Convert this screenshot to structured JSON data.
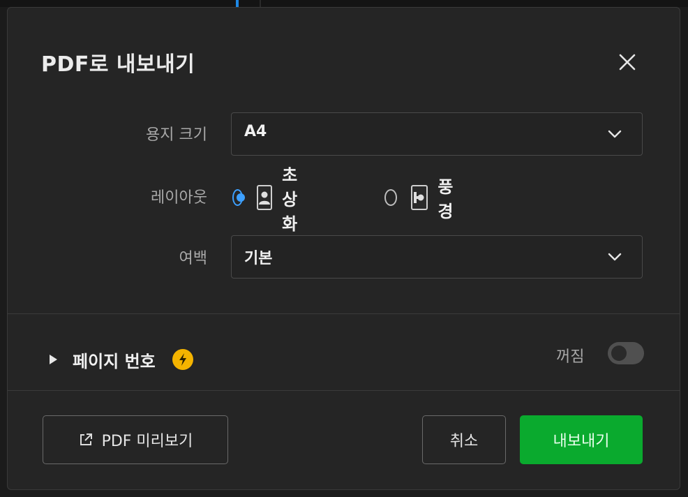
{
  "dialog": {
    "title": "PDF로 내보내기",
    "close_icon": "close-icon"
  },
  "paper_size": {
    "label": "용지 크기",
    "value": "A4"
  },
  "layout": {
    "label": "레이아웃",
    "options": [
      {
        "label": "초상화",
        "icon": "portrait-icon",
        "checked": true
      },
      {
        "label": "풍경",
        "icon": "landscape-icon",
        "checked": false
      }
    ]
  },
  "margin": {
    "label": "여백",
    "value": "기본"
  },
  "page_number": {
    "title": "페이지 번호",
    "badge_icon": "lightning-icon",
    "toggle_label": "꺼짐",
    "enabled": false
  },
  "footer": {
    "preview_label": "PDF 미리보기",
    "cancel_label": "취소",
    "export_label": "내보내기"
  },
  "colors": {
    "accent_blue": "#3da0ff",
    "export_green": "#0aaa2e",
    "badge_yellow": "#f5b400"
  }
}
